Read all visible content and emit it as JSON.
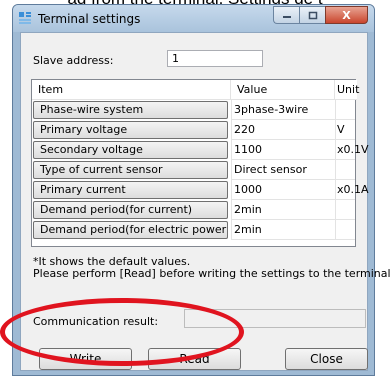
{
  "background_text": "ad from the terminal. Settings de t",
  "window": {
    "title": "Terminal settings",
    "minimize_icon": "minimize-icon",
    "maximize_icon": "maximize-icon",
    "close_icon": "close-icon",
    "close_glyph": "X"
  },
  "slave": {
    "label": "Slave address:",
    "value": "1"
  },
  "grid": {
    "headers": {
      "item": "Item",
      "value": "Value",
      "unit": "Unit"
    },
    "rows": [
      {
        "item": "Phase-wire system",
        "value": "3phase-3wire",
        "unit": ""
      },
      {
        "item": "Primary voltage",
        "value": "220",
        "unit": "V"
      },
      {
        "item": "Secondary voltage",
        "value": "1100",
        "unit": "x0.1V"
      },
      {
        "item": "Type of current sensor",
        "value": "Direct sensor",
        "unit": ""
      },
      {
        "item": "Primary current",
        "value": "1000",
        "unit": "x0.1A"
      },
      {
        "item": "Demand period(for current)",
        "value": "2min",
        "unit": ""
      },
      {
        "item": "Demand period(for electric power)",
        "value": "2min",
        "unit": ""
      }
    ]
  },
  "note": {
    "line1": "*It shows the default values.",
    "line2": "Please perform [Read] before writing the settings to the terminal."
  },
  "communication": {
    "label": "Communication result:",
    "value": ""
  },
  "buttons": {
    "write": "Write",
    "read": "Read",
    "close": "Close"
  },
  "colors": {
    "highlight_ellipse": "#e0141f",
    "titlebar": "#a9c3dc"
  }
}
